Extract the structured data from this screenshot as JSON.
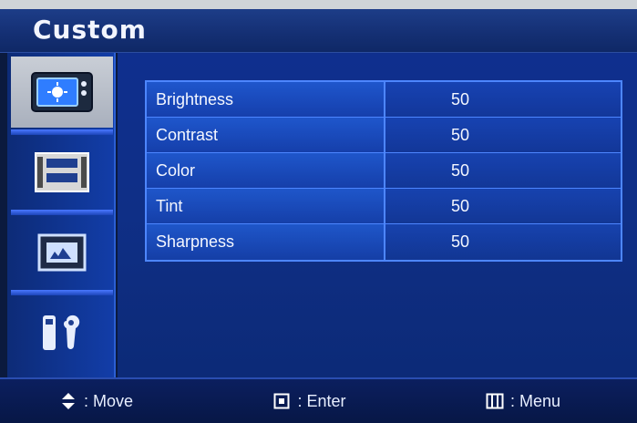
{
  "header": {
    "title": "Custom"
  },
  "sidebar": {
    "items": [
      {
        "name": "picture",
        "icon": "tv-icon",
        "selected": true
      },
      {
        "name": "display",
        "icon": "film-strip-icon",
        "selected": false
      },
      {
        "name": "screen",
        "icon": "picture-icon",
        "selected": false
      },
      {
        "name": "tools",
        "icon": "tools-icon",
        "selected": false
      }
    ]
  },
  "settings": [
    {
      "label": "Brightness",
      "value": "50"
    },
    {
      "label": "Contrast",
      "value": "50"
    },
    {
      "label": "Color",
      "value": "50"
    },
    {
      "label": "Tint",
      "value": "50"
    },
    {
      "label": "Sharpness",
      "value": "50"
    }
  ],
  "footer": {
    "move_label": ": Move",
    "enter_label": ": Enter",
    "menu_label": ": Menu"
  },
  "colors": {
    "panel_blue": "#0f2f8e",
    "row_border": "#4d86ff",
    "header_text": "#f2f5ff"
  }
}
